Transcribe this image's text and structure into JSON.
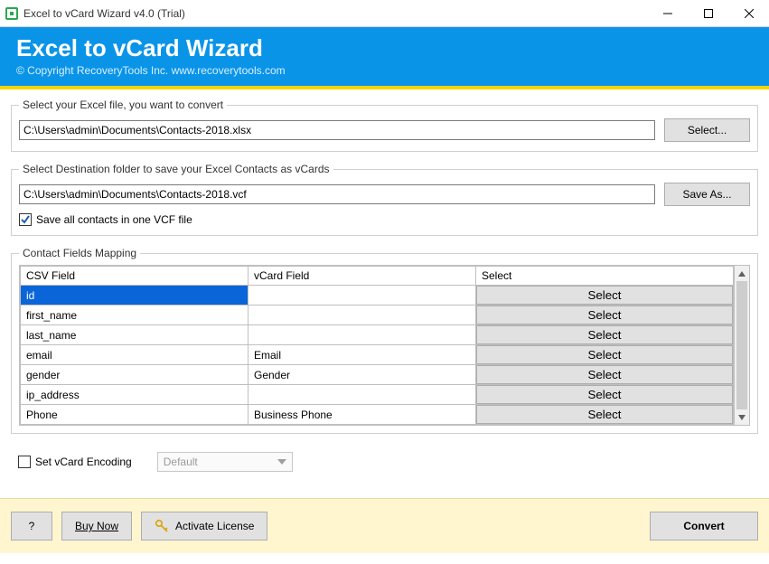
{
  "window": {
    "title": "  Excel to vCard Wizard v4.0 (Trial)"
  },
  "banner": {
    "heading": "Excel to vCard Wizard",
    "sub": "© Copyright RecoveryTools Inc. www.recoverytools.com"
  },
  "source": {
    "legend": "Select your Excel file, you want to convert",
    "path": "C:\\Users\\admin\\Documents\\Contacts-2018.xlsx",
    "select_label": "Select..."
  },
  "dest": {
    "legend": "Select Destination folder to save your Excel Contacts as vCards",
    "path": "C:\\Users\\admin\\Documents\\Contacts-2018.vcf",
    "saveas_label": "Save As...",
    "single_file_checked": true,
    "single_file_label": "Save all contacts in one VCF file"
  },
  "mapping": {
    "legend": "Contact Fields Mapping",
    "headers": {
      "csv": "CSV Field",
      "vcard": "vCard Field",
      "select": "Select"
    },
    "select_button_label": "Select",
    "rows": [
      {
        "csv": "id",
        "vcard": "",
        "selected": true
      },
      {
        "csv": "first_name",
        "vcard": "",
        "selected": false
      },
      {
        "csv": "last_name",
        "vcard": "",
        "selected": false
      },
      {
        "csv": "email",
        "vcard": "Email",
        "selected": false
      },
      {
        "csv": "gender",
        "vcard": "Gender",
        "selected": false
      },
      {
        "csv": "ip_address",
        "vcard": "",
        "selected": false
      },
      {
        "csv": "Phone",
        "vcard": "Business Phone",
        "selected": false
      }
    ]
  },
  "encoding": {
    "checked": false,
    "label": "Set vCard Encoding",
    "combo_value": "Default"
  },
  "footer": {
    "help": "?",
    "buy": "Buy Now",
    "activate": "Activate License",
    "convert": "Convert"
  }
}
